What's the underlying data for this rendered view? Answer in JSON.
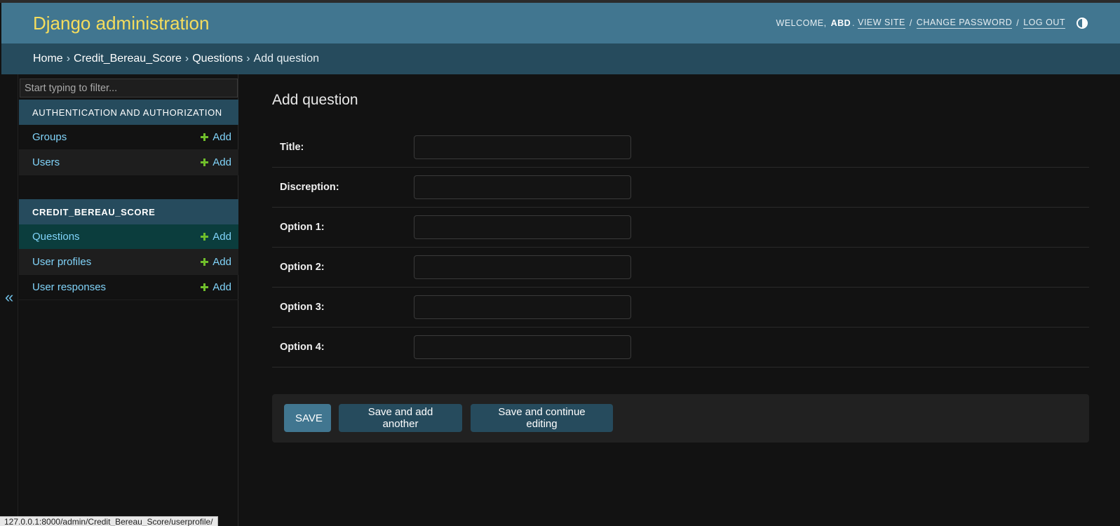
{
  "header": {
    "site_name": "Django administration",
    "welcome": "WELCOME,",
    "username": "ABD",
    "view_site": "VIEW SITE",
    "change_password": "CHANGE PASSWORD",
    "log_out": "LOG OUT",
    "separator": "/"
  },
  "breadcrumbs": {
    "home": "Home",
    "app": "Credit_Bereau_Score",
    "model": "Questions",
    "current": "Add question",
    "arrow": "›"
  },
  "sidebar": {
    "filter_placeholder": "Start typing to filter...",
    "modules": [
      {
        "caption": "Authentication and Authorization",
        "items": [
          {
            "label": "Groups",
            "add": "Add"
          },
          {
            "label": "Users",
            "add": "Add"
          }
        ]
      },
      {
        "caption": "Credit_Bereau_Score",
        "items": [
          {
            "label": "Questions",
            "add": "Add"
          },
          {
            "label": "User profiles",
            "add": "Add"
          },
          {
            "label": "User responses",
            "add": "Add"
          }
        ]
      }
    ],
    "collapse_glyph": "«"
  },
  "content": {
    "title": "Add question",
    "fields": [
      {
        "label": "Title:",
        "value": ""
      },
      {
        "label": "Discreption:",
        "value": ""
      },
      {
        "label": "Option 1:",
        "value": ""
      },
      {
        "label": "Option 2:",
        "value": ""
      },
      {
        "label": "Option 3:",
        "value": ""
      },
      {
        "label": "Option 4:",
        "value": ""
      }
    ],
    "buttons": {
      "save": "SAVE",
      "save_add_another": "Save and add another",
      "save_continue": "Save and continue editing"
    }
  },
  "status_bar": {
    "url": "127.0.0.1:8000/admin/Credit_Bereau_Score/userprofile/"
  },
  "colors": {
    "header_bg": "#417690",
    "breadcrumb_bg": "#264b5d",
    "branding": "#f5dd5d",
    "link": "#81d4fa",
    "add_plus": "#70bf2b",
    "body_bg": "#121212"
  }
}
